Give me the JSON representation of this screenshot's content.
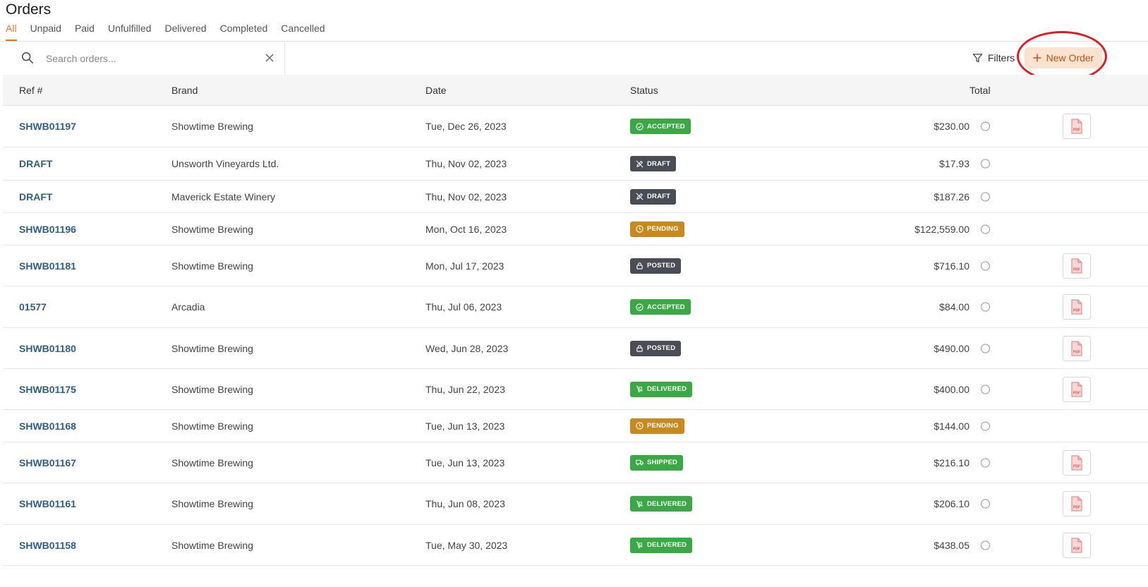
{
  "page": {
    "title": "Orders"
  },
  "tabs": [
    "All",
    "Unpaid",
    "Paid",
    "Unfulfilled",
    "Delivered",
    "Completed",
    "Cancelled"
  ],
  "search": {
    "placeholder": "Search orders...",
    "value": ""
  },
  "toolbar": {
    "filters_label": "Filters",
    "new_order_label": "New Order"
  },
  "columns": {
    "ref": "Ref #",
    "brand": "Brand",
    "date": "Date",
    "status": "Status",
    "total": "Total"
  },
  "status_colors": {
    "ACCEPTED": "#3aa845",
    "DRAFT": "#4a4d55",
    "PENDING": "#c8891f",
    "POSTED": "#4a4d55",
    "DELIVERED": "#3aa845",
    "SHIPPED": "#3aa845"
  },
  "rows": [
    {
      "ref": "SHWB01197",
      "brand": "Showtime Brewing",
      "date": "Tue, Dec 26, 2023",
      "status": "ACCEPTED",
      "icon": "check-circle-icon",
      "total": "$230.00",
      "pdf": true
    },
    {
      "ref": "DRAFT",
      "brand": "Unsworth Vineyards Ltd.",
      "date": "Thu, Nov 02, 2023",
      "status": "DRAFT",
      "icon": "pencil-icon",
      "total": "$17.93",
      "pdf": false
    },
    {
      "ref": "DRAFT",
      "brand": "Maverick Estate Winery",
      "date": "Thu, Nov 02, 2023",
      "status": "DRAFT",
      "icon": "pencil-icon",
      "total": "$187.26",
      "pdf": false
    },
    {
      "ref": "SHWB01196",
      "brand": "Showtime Brewing",
      "date": "Mon, Oct 16, 2023",
      "status": "PENDING",
      "icon": "clock-icon",
      "total": "$122,559.00",
      "pdf": false
    },
    {
      "ref": "SHWB01181",
      "brand": "Showtime Brewing",
      "date": "Mon, Jul 17, 2023",
      "status": "POSTED",
      "icon": "lock-icon",
      "total": "$716.10",
      "pdf": true
    },
    {
      "ref": "01577",
      "brand": "Arcadia",
      "date": "Thu, Jul 06, 2023",
      "status": "ACCEPTED",
      "icon": "check-circle-icon",
      "total": "$84.00",
      "pdf": true
    },
    {
      "ref": "SHWB01180",
      "brand": "Showtime Brewing",
      "date": "Wed, Jun 28, 2023",
      "status": "POSTED",
      "icon": "lock-icon",
      "total": "$490.00",
      "pdf": true
    },
    {
      "ref": "SHWB01175",
      "brand": "Showtime Brewing",
      "date": "Thu, Jun 22, 2023",
      "status": "DELIVERED",
      "icon": "dolly-icon",
      "total": "$400.00",
      "pdf": true
    },
    {
      "ref": "SHWB01168",
      "brand": "Showtime Brewing",
      "date": "Tue, Jun 13, 2023",
      "status": "PENDING",
      "icon": "clock-icon",
      "total": "$144.00",
      "pdf": false
    },
    {
      "ref": "SHWB01167",
      "brand": "Showtime Brewing",
      "date": "Tue, Jun 13, 2023",
      "status": "SHIPPED",
      "icon": "truck-icon",
      "total": "$216.10",
      "pdf": true
    },
    {
      "ref": "SHWB01161",
      "brand": "Showtime Brewing",
      "date": "Thu, Jun 08, 2023",
      "status": "DELIVERED",
      "icon": "dolly-icon",
      "total": "$206.10",
      "pdf": true
    },
    {
      "ref": "SHWB01158",
      "brand": "Showtime Brewing",
      "date": "Tue, May 30, 2023",
      "status": "DELIVERED",
      "icon": "dolly-icon",
      "total": "$438.05",
      "pdf": true
    }
  ]
}
